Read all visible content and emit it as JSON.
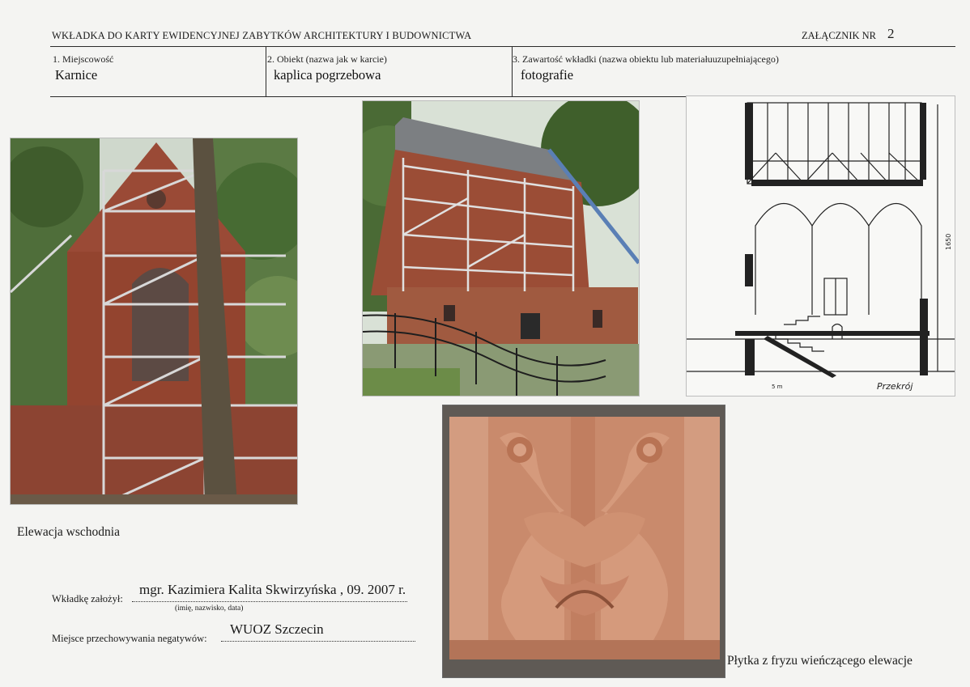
{
  "header": {
    "title": "WKŁADKA DO KARTY EWIDENCYJNEJ ZABYTKÓW ARCHITEKTURY I BUDOWNICTWA",
    "annex_label": "ZAŁĄCZNIK NR",
    "annex_number": "2"
  },
  "fields": {
    "locality_label": "1. Miejscowość",
    "locality_value": "Karnice",
    "object_label": "2. Obiekt (nazwa jak w karcie)",
    "object_value": "kaplica pogrzebowa",
    "content_label": "3. Zawartość wkładki (nazwa obiektu lub materiałuuzupełniającego)",
    "content_value": "fotografie"
  },
  "photos": {
    "east_elevation_caption": "Elewacja wschodnia",
    "frieze_caption": "Płytka z fryzu wieńczącego elewacje",
    "section_label": "Przekrój",
    "section_height_mark": "1650",
    "section_scale_mark": "5 m"
  },
  "signature": {
    "author_label": "Wkładkę założył:",
    "author_value": "mgr. Kazimiera Kalita Skwirzyńska , 09. 2007 r.",
    "author_hint": "(imię, nazwisko, data)",
    "storage_label": "Miejsce przechowywania negatywów:",
    "storage_value": "WUOZ Szczecin"
  }
}
